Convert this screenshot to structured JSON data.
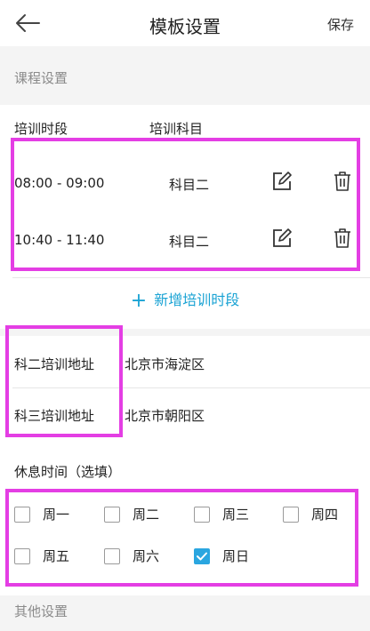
{
  "header": {
    "title": "模板设置",
    "save_label": "保存"
  },
  "course_section": {
    "label": "课程设置",
    "col_period": "培训时段",
    "col_subject": "培训科目",
    "rows": [
      {
        "time": "08:00 - 09:00",
        "subject": "科目二"
      },
      {
        "time": "10:40 - 11:40",
        "subject": "科目二"
      }
    ],
    "add_label": "新增培训时段"
  },
  "address_section": {
    "rows": [
      {
        "label": "科二培训地址",
        "value": "北京市海淀区"
      },
      {
        "label": "科三培训地址",
        "value": "北京市朝阳区"
      }
    ]
  },
  "rest_section": {
    "label": "休息时间（选填）",
    "days": [
      {
        "label": "周一",
        "checked": false
      },
      {
        "label": "周二",
        "checked": false
      },
      {
        "label": "周三",
        "checked": false
      },
      {
        "label": "周四",
        "checked": false
      },
      {
        "label": "周五",
        "checked": false
      },
      {
        "label": "周六",
        "checked": false
      },
      {
        "label": "周日",
        "checked": true
      }
    ]
  },
  "other_section": {
    "label": "其他设置"
  },
  "colors": {
    "accent": "#1aa3d4",
    "checkbox_checked": "#2aa6e0",
    "highlight": "#e43ee4"
  }
}
